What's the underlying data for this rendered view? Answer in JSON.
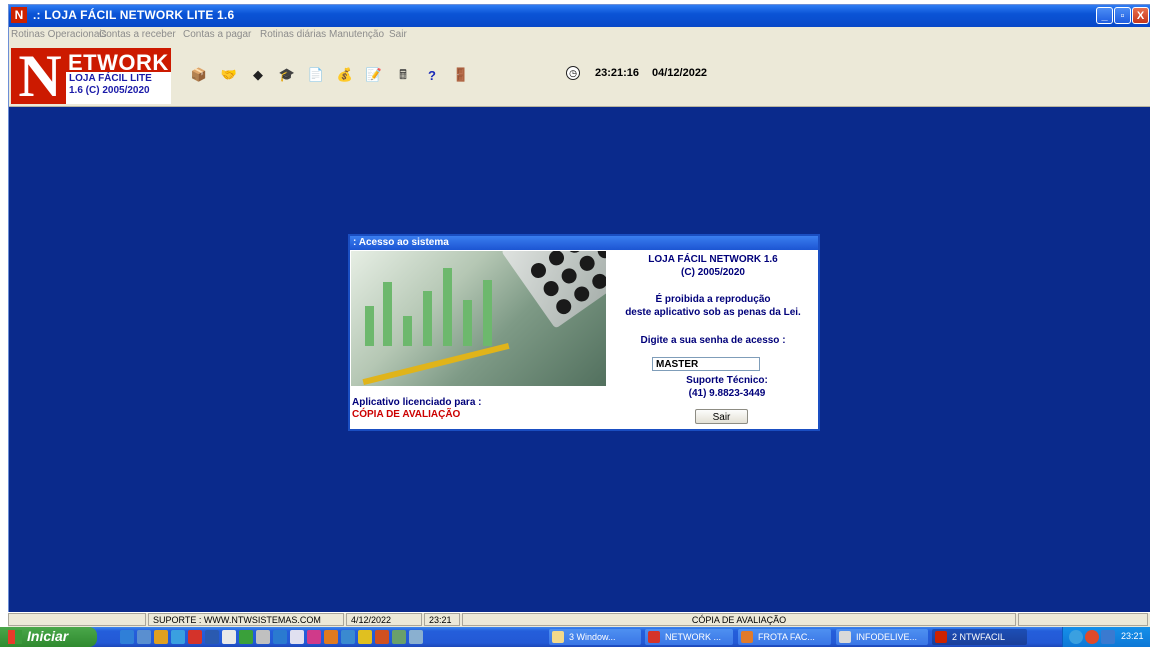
{
  "window": {
    "icon_letter": "N",
    "title": ".: LOJA FÁCIL NETWORK LITE 1.6",
    "minimize": "_",
    "maximize": "▫",
    "close": "X"
  },
  "menu": [
    "Rotinas Operacionais",
    "Contas a receber",
    "Contas a pagar",
    "Rotinas diárias",
    "Manutenção",
    "Sair"
  ],
  "logo": {
    "letter": "N",
    "wordmark": "ETWORK",
    "line1": "LOJA FÁCIL LITE",
    "line2": "1.6 (C) 2005/2020"
  },
  "toolbar": {
    "tools": [
      {
        "icon": "box-icon",
        "glyph": "📦"
      },
      {
        "icon": "handshake-icon",
        "glyph": "🤝"
      },
      {
        "icon": "diamond-icon",
        "glyph": "◆"
      },
      {
        "icon": "graduation-cap-icon",
        "glyph": "🎓"
      },
      {
        "icon": "copy-document-icon",
        "glyph": "📄"
      },
      {
        "icon": "money-bag-icon",
        "glyph": "💰"
      },
      {
        "icon": "notepad-icon",
        "glyph": "📝"
      },
      {
        "icon": "cash-register-icon",
        "glyph": "🖩"
      },
      {
        "icon": "help-icon",
        "glyph": "?"
      },
      {
        "icon": "exit-door-icon",
        "glyph": "🚪"
      }
    ],
    "clock_glyph": "◷",
    "time": "23:21:16",
    "date": "04/12/2022"
  },
  "dialog": {
    "title": ": Acesso ao sistema",
    "product": "LOJA FÁCIL NETWORK 1.6",
    "copyright": "(C) 2005/2020",
    "warning_line1": "É proibida a reprodução",
    "warning_line2": "deste aplicativo sob as penas da Lei.",
    "password_label": "Digite a sua senha de acesso :",
    "password_value": "MASTER",
    "support_label": "Suporte Técnico:",
    "support_phone": "(41) 9.8823-3449",
    "exit_button": "Sair",
    "licensed_label": "Aplicativo licenciado para :",
    "licensed_value": "CÓPIA DE AVALIAÇÃO"
  },
  "statusbar": {
    "support": "SUPORTE : WWW.NTWSISTEMAS.COM",
    "date": "4/12/2022",
    "time": "23:21",
    "license": "CÓPIA DE AVALIAÇÃO"
  },
  "taskbar": {
    "start_label": "Iniciar",
    "tasks": [
      {
        "label": "3 Window...",
        "color": "#f3d98a"
      },
      {
        "label": "NETWORK ...",
        "color": "#d4332a"
      },
      {
        "label": "FROTA FAC...",
        "color": "#e07a2a"
      },
      {
        "label": "INFODELIVE...",
        "color": "#d9d9d9"
      },
      {
        "label": "2 NTWFACIL",
        "color": "#cc2200"
      }
    ],
    "tray_time": "23:21"
  }
}
